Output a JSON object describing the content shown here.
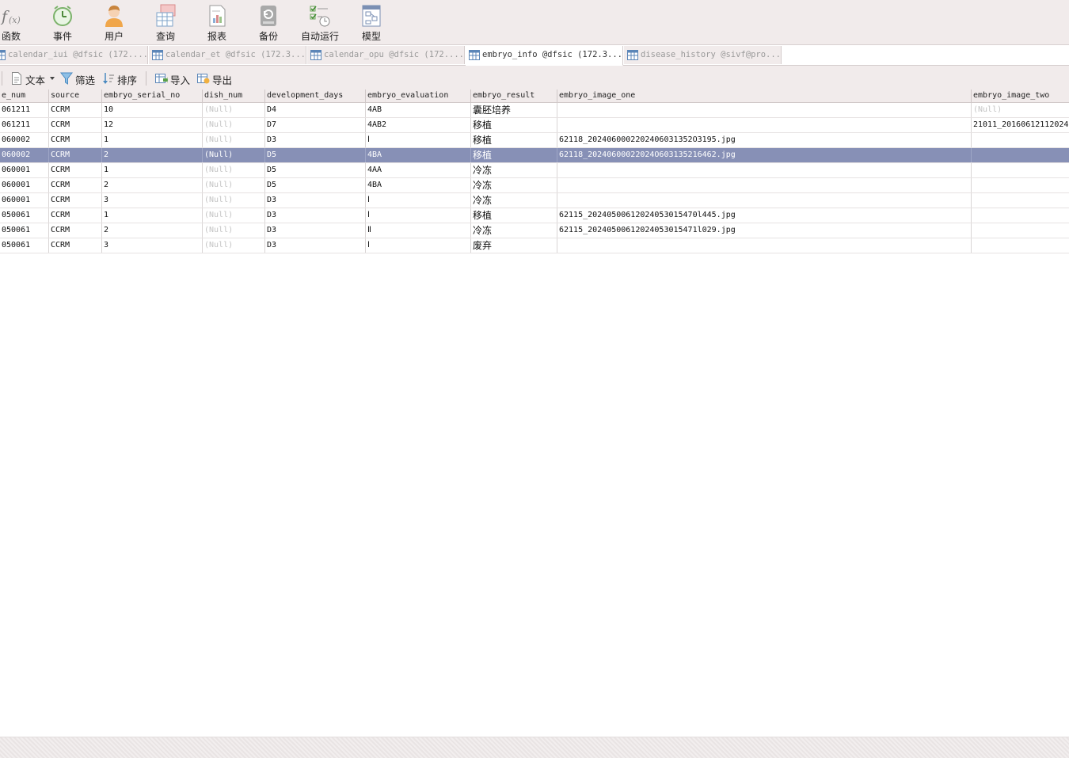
{
  "ribbon": [
    {
      "label": "函数",
      "icon": "function-icon"
    },
    {
      "label": "事件",
      "icon": "alarm-clock-icon"
    },
    {
      "label": "用户",
      "icon": "user-icon"
    },
    {
      "label": "查询",
      "icon": "query-icon"
    },
    {
      "label": "报表",
      "icon": "report-icon"
    },
    {
      "label": "备份",
      "icon": "backup-icon"
    },
    {
      "label": "自动运行",
      "icon": "automation-icon"
    },
    {
      "label": "模型",
      "icon": "model-icon"
    }
  ],
  "tabs": [
    {
      "label": "calendar_iui @dfsic (172....",
      "active": false
    },
    {
      "label": "calendar_et @dfsic (172.3...",
      "active": false
    },
    {
      "label": "calendar_opu @dfsic (172....",
      "active": false
    },
    {
      "label": "embryo_info @dfsic (172.3...",
      "active": true
    },
    {
      "label": "disease_history @sivf@pro...",
      "active": false
    }
  ],
  "toolbar": {
    "text": "文本",
    "filter": "筛选",
    "sort": "排序",
    "import": "导入",
    "export": "导出"
  },
  "table": {
    "columns": [
      "e_num",
      "source",
      "embryo_serial_no",
      "dish_num",
      "development_days",
      "embryo_evaluation",
      "embryo_result",
      "embryo_image_one",
      "embryo_image_two"
    ],
    "selected_row": 3,
    "rows": [
      [
        "061211",
        "CCRM",
        "10",
        "(Null)",
        "D4",
        "4AB",
        "囊胚培养",
        "",
        "(Null)"
      ],
      [
        "061211",
        "CCRM",
        "12",
        "(Null)",
        "D7",
        "4AB2",
        "移植",
        "",
        "21011_20160612112024"
      ],
      [
        "060002",
        "CCRM",
        "1",
        "(Null)",
        "D3",
        "Ⅰ",
        "移植",
        "62118_2024060002202406031352O3195.jpg",
        ""
      ],
      [
        "060002",
        "CCRM",
        "2",
        "(Null)",
        "D5",
        "4BA",
        "移植",
        "62118_20240600022024O603135216462.jpg",
        ""
      ],
      [
        "060001",
        "CCRM",
        "1",
        "(Null)",
        "D5",
        "4AA",
        "冷冻",
        "",
        ""
      ],
      [
        "060001",
        "CCRM",
        "2",
        "(Null)",
        "D5",
        "4BA",
        "冷冻",
        "",
        ""
      ],
      [
        "060001",
        "CCRM",
        "3",
        "(Null)",
        "D3",
        "Ⅰ",
        "冷冻",
        "",
        ""
      ],
      [
        "050061",
        "CCRM",
        "1",
        "(Null)",
        "D3",
        "Ⅰ",
        "移植",
        "62115_20240500612024053015470l445.jpg",
        ""
      ],
      [
        "050061",
        "CCRM",
        "2",
        "(Null)",
        "D3",
        "Ⅱ",
        "冷冻",
        "62115_20240500612024053015471l029.jpg",
        ""
      ],
      [
        "050061",
        "CCRM",
        "3",
        "(Null)",
        "D3",
        "Ⅰ",
        "废弃",
        "",
        ""
      ]
    ]
  }
}
